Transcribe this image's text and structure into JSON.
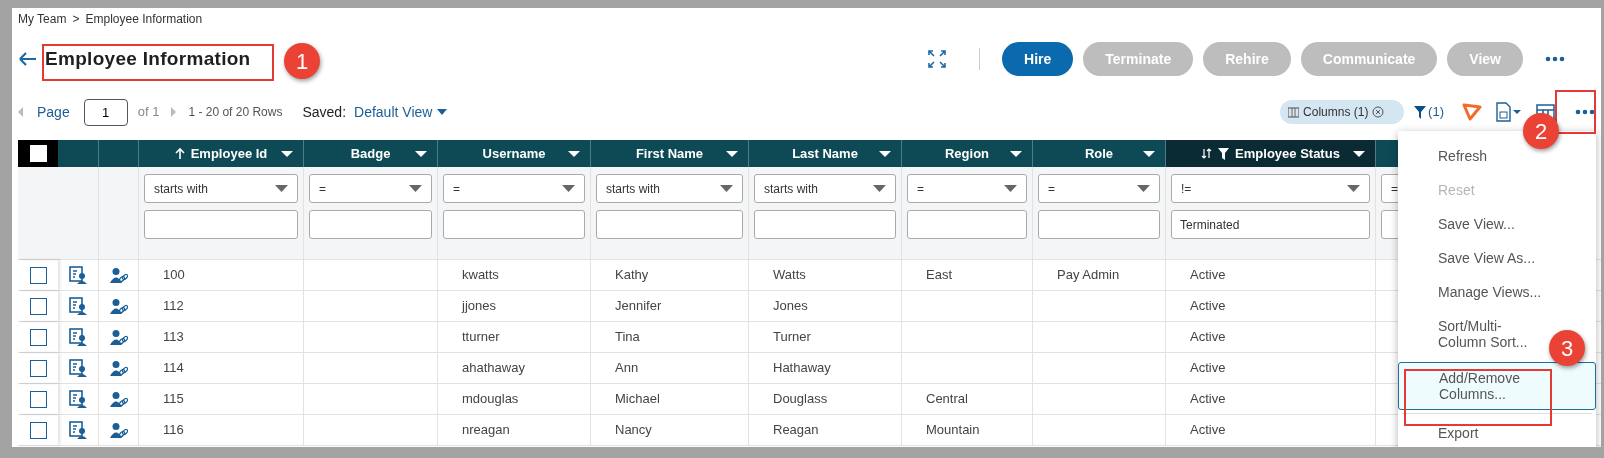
{
  "breadcrumb": {
    "items": [
      "My Team",
      "Employee Information"
    ],
    "separator": ">"
  },
  "title": "Employee Information",
  "actions": [
    {
      "label": "Hire",
      "disabled": false
    },
    {
      "label": "Terminate",
      "disabled": true
    },
    {
      "label": "Rehire",
      "disabled": true
    },
    {
      "label": "Communicate",
      "disabled": true
    },
    {
      "label": "View",
      "disabled": true
    }
  ],
  "pager": {
    "page_label": "Page",
    "page": "1",
    "of": "of 1",
    "rows": "1 - 20 of 20 Rows"
  },
  "saved": {
    "label": "Saved:",
    "view": "Default View"
  },
  "filter_chip": "Columns (1)",
  "filter_count": "(1)",
  "table": {
    "select_all": {
      "checked": false
    },
    "columns": [
      {
        "label": "Employee Id",
        "sorted_ascending": true,
        "filtered": false,
        "operator": "starts with"
      },
      {
        "label": "Badge",
        "filtered": false,
        "operator": "="
      },
      {
        "label": "Username",
        "filtered": false,
        "operator": "="
      },
      {
        "label": "First Name",
        "filtered": false,
        "operator": "starts with"
      },
      {
        "label": "Last Name",
        "filtered": false,
        "operator": "starts with"
      },
      {
        "label": "Region",
        "filtered": false,
        "operator": "="
      },
      {
        "label": "Role",
        "filtered": false,
        "operator": "="
      },
      {
        "label": "Employee Status",
        "sortable": true,
        "filtered": true,
        "operator": "!=",
        "value": "Terminated"
      },
      {
        "operator": "="
      }
    ],
    "rows": [
      {
        "checked": false,
        "cells": [
          "100",
          null,
          "kwatts",
          "Kathy",
          "Watts",
          "East",
          "Pay Admin",
          "Active",
          null
        ]
      },
      {
        "checked": false,
        "cells": [
          "112",
          null,
          "jjones",
          "Jennifer",
          "Jones",
          null,
          null,
          "Active",
          null
        ]
      },
      {
        "checked": false,
        "cells": [
          "113",
          null,
          "tturner",
          "Tina",
          "Turner",
          null,
          null,
          "Active",
          null
        ]
      },
      {
        "checked": false,
        "cells": [
          "114",
          null,
          "ahathaway",
          "Ann",
          "Hathaway",
          null,
          null,
          "Active",
          null
        ]
      },
      {
        "checked": false,
        "cells": [
          "115",
          null,
          "mdouglas",
          "Michael",
          "Douglass",
          "Central",
          null,
          "Active",
          null
        ]
      },
      {
        "checked": false,
        "cells": [
          "116",
          null,
          "nreagan",
          "Nancy",
          "Reagan",
          "Mountain",
          null,
          "Active",
          null
        ]
      }
    ]
  },
  "menu": [
    {
      "label": "Refresh",
      "disabled": false,
      "selected": false
    },
    {
      "label": "Reset",
      "disabled": true,
      "selected": false
    },
    {
      "label": "Save View...",
      "disabled": false,
      "selected": false
    },
    {
      "label": "Save View As...",
      "disabled": false,
      "selected": false
    },
    {
      "label": "Manage Views...",
      "disabled": false,
      "selected": false
    },
    {
      "label": "Sort/Multi-Column Sort...",
      "disabled": false,
      "selected": false
    },
    {
      "label": "Add/Remove Columns...",
      "disabled": false,
      "selected": true
    },
    {
      "label": "Export",
      "disabled": false,
      "selected": false
    }
  ],
  "annotations": [
    {
      "label": "1"
    },
    {
      "label": "2"
    },
    {
      "label": "3"
    }
  ]
}
